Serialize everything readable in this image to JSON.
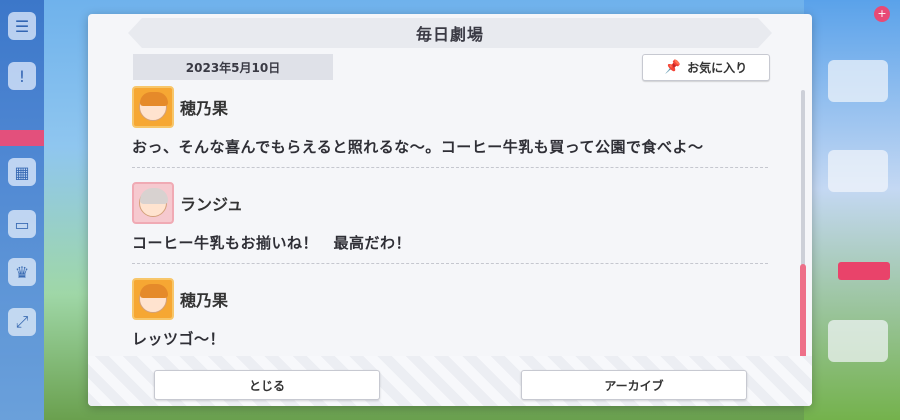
{
  "dialog": {
    "title": "毎日劇場",
    "date": "2023年5月10日",
    "favorite_label": "お気に入り",
    "close_label": "とじる",
    "archive_label": "アーカイブ"
  },
  "entries": [
    {
      "speaker": "穂乃果",
      "text": "おっ、そんな喜んでもらえると照れるな～。コーヒー牛乳も買って公園で食べよ～"
    },
    {
      "speaker": "ランジュ",
      "text": "コーヒー牛乳もお揃いね！　最高だわ！"
    },
    {
      "speaker": "穂乃果",
      "text": "レッツゴ～！"
    }
  ],
  "icons": {
    "favorite": "pin-icon",
    "avatar_1": "honoka-avatar",
    "avatar_2": "lanzhu-avatar"
  },
  "colors": {
    "scroll_thumb": "#ee6f88",
    "modal_bg": "#f5f6f9"
  }
}
